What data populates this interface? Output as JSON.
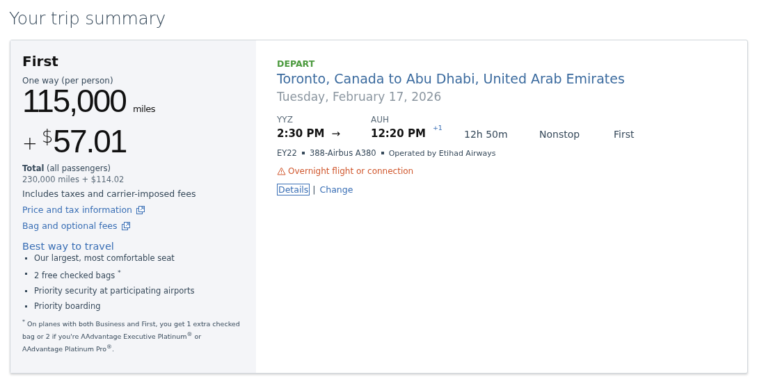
{
  "page_title": "Your trip summary",
  "fare": {
    "cabin": "First",
    "per_person_label": "One way (per person)",
    "miles": "115,000",
    "miles_unit": "miles",
    "plus": "+",
    "currency": "$",
    "cash": "57.01",
    "total_label": "**Total** (all passengers)",
    "total_value": "230,000 miles + $114.02",
    "includes": "Includes taxes and carrier-imposed fees",
    "links": [
      {
        "label": "Price and tax information"
      },
      {
        "label": "Bag and optional fees"
      }
    ],
    "benefits_title": "Best way to travel",
    "benefits": [
      "Our largest, most comfortable seat",
      "2 free checked bags $^{*}$",
      "Priority security at participating airports",
      "Priority boarding"
    ],
    "footnote": "$^{*}$ On planes with both Business and First, you get 1 extra checked bag or 2 if you're AAdvantage Executive Platinum$^{®}$ or AAdvantage Platinum Pro$^{®}$."
  },
  "flight": {
    "direction": "DEPART",
    "route": "Toronto, Canada to Abu Dhabi, United Arab Emirates",
    "date": "Tuesday, February 17, 2026",
    "origin_code": "YYZ",
    "depart_time": "2:30 PM",
    "arrow": "→",
    "dest_code": "AUH",
    "arrive_time": "12:20 PM",
    "day_offset": "+1",
    "duration": "12h 50m",
    "stops": "Nonstop",
    "cabin": "First",
    "details": [
      {
        "text": "EY22",
        "kind": "plain"
      },
      {
        "text": "388-Airbus A380",
        "kind": "plain"
      },
      {
        "text": "Operated by Etihad Airways",
        "kind": "small"
      }
    ],
    "warning": "Overnight flight or connection",
    "actions": [
      {
        "label": "Details",
        "focused": true
      },
      {
        "label": "Change",
        "focused": false
      }
    ],
    "action_separator": "|"
  }
}
